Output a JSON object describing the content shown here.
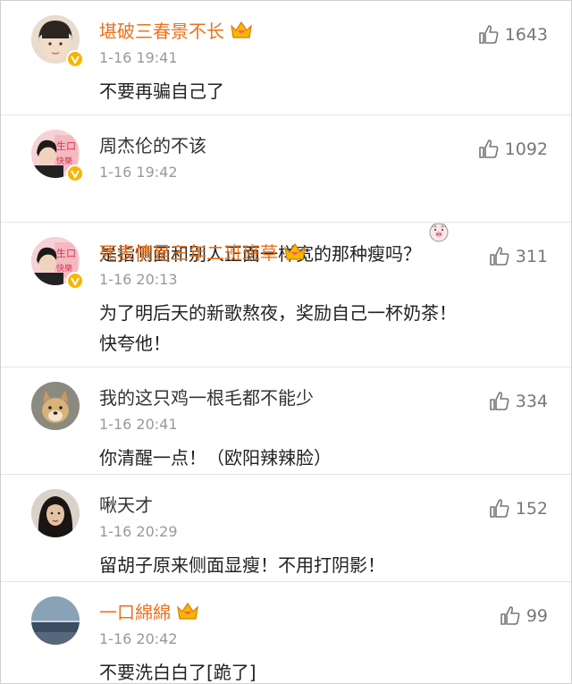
{
  "comments": [
    {
      "avatar": "girl-bangs-avatar",
      "username": "堪破三春景不长",
      "vip": true,
      "verified": true,
      "time": "1-16 19:41",
      "text": "不要再骗自己了",
      "likes": "1643"
    },
    {
      "avatar": "birthday-poster-avatar",
      "username": "周杰伦的不该",
      "vip": false,
      "verified": true,
      "time": "1-16 19:42",
      "text": "是指侧面和别人正面一样宽的那种瘦吗？",
      "emoji": "pig-face-emoji",
      "likes": "1092"
    },
    {
      "avatar": "birthday-poster-avatar",
      "username": "死表情是三年二班班草",
      "vip": true,
      "verified": true,
      "time": "1-16 20:13",
      "text": "为了明后天的新歌熬夜，奖励自己一杯奶茶！\n快夸他！",
      "likes": "311"
    },
    {
      "avatar": "shiba-dog-avatar",
      "username": "我的这只鸡一根毛都不能少",
      "vip": false,
      "verified": false,
      "time": "1-16 20:41",
      "text": "你清醒一点！（欧阳辣辣脸）",
      "likes": "334"
    },
    {
      "avatar": "woman-portrait-avatar",
      "username": "啾天才",
      "vip": false,
      "verified": false,
      "time": "1-16 20:29",
      "text": "留胡子原来侧面显瘦！不用打阴影！",
      "likes": "152"
    },
    {
      "avatar": "seascape-avatar",
      "username": "一口綿綿",
      "vip": true,
      "verified": false,
      "time": "1-16 20:42",
      "text": "不要洗白白了[跪了]",
      "likes": "99"
    }
  ],
  "colors": {
    "vip_name": "#e8711c",
    "plain_name": "#333333",
    "time": "#999999",
    "like": "#777777",
    "verified_badge": "#f7b500"
  }
}
